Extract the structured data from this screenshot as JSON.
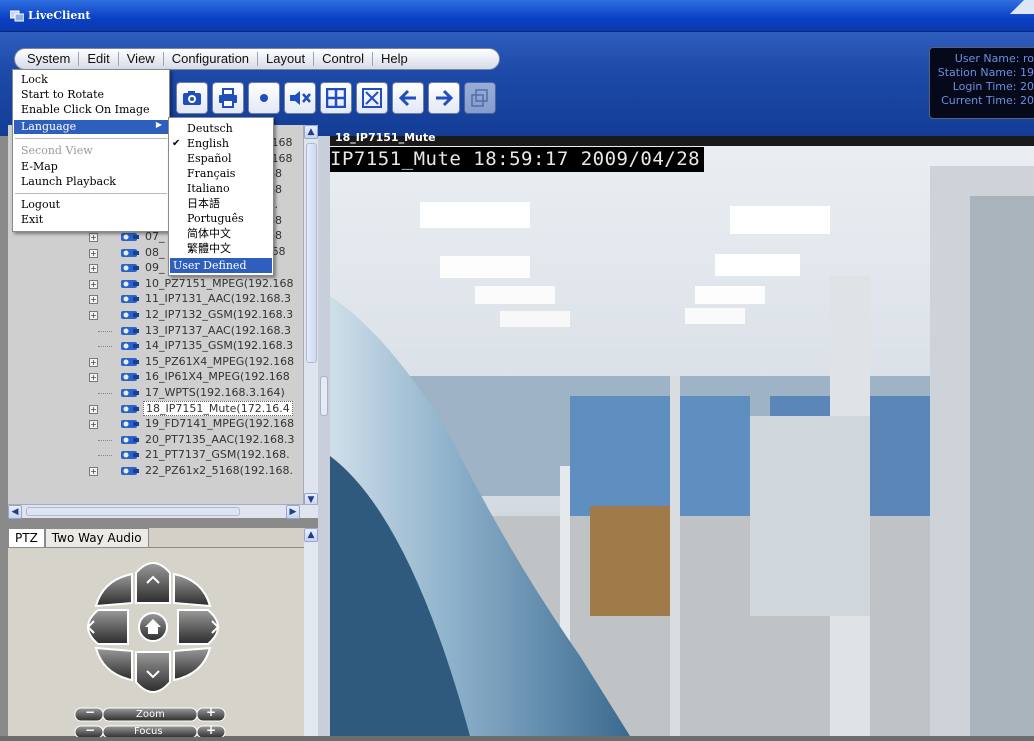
{
  "window": {
    "title": "LiveClient"
  },
  "menubar": {
    "items": [
      "System",
      "Edit",
      "View",
      "Configuration",
      "Layout",
      "Control",
      "Help"
    ]
  },
  "info": {
    "user_name": "User Name: ro",
    "station_name": "Station Name: 19",
    "login_time": "Login Time: 20",
    "current_time": "Current Time: 20"
  },
  "system_menu": {
    "items": [
      {
        "label": "Lock",
        "state": "normal"
      },
      {
        "label": "Start to Rotate",
        "state": "normal"
      },
      {
        "label": "Enable Click On Image",
        "state": "normal"
      },
      {
        "label": "Language",
        "state": "highlighted",
        "submenu": true
      },
      {
        "label": "Second View",
        "state": "disabled"
      },
      {
        "label": "E-Map",
        "state": "normal"
      },
      {
        "label": "Launch Playback",
        "state": "normal"
      },
      {
        "label": "Logout",
        "state": "normal"
      },
      {
        "label": "Exit",
        "state": "normal"
      }
    ]
  },
  "language_menu": {
    "items": [
      "Deutsch",
      "English",
      "Español",
      "Français",
      "Italiano",
      "日本語",
      "Português",
      "简体中文",
      "繁體中文",
      "User Defined"
    ],
    "checked": "English",
    "highlighted": "User Defined"
  },
  "tree": {
    "items": [
      {
        "label": "07_",
        "expand": true
      },
      {
        "label": "08_",
        "expand": true
      },
      {
        "label": "09_",
        "expand": true
      },
      {
        "label": "10_PZ7151_MPEG(192.168",
        "expand": true
      },
      {
        "label": "11_IP7131_AAC(192.168.3",
        "expand": true
      },
      {
        "label": "12_IP7132_GSM(192.168.3",
        "expand": true
      },
      {
        "label": "13_IP7137_AAC(192.168.3",
        "expand": false
      },
      {
        "label": "14_IP7135_GSM(192.168.3",
        "expand": false
      },
      {
        "label": "15_PZ61X4_MPEG(192.168",
        "expand": true
      },
      {
        "label": "16_IP61X4_MPEG(192.168",
        "expand": true
      },
      {
        "label": "17_WPTS(192.168.3.164)",
        "expand": false
      },
      {
        "label": "18_IP7151_Mute(172.16.4",
        "expand": true,
        "selected": true
      },
      {
        "label": "19_FD7141_MPEG(192.168",
        "expand": true
      },
      {
        "label": "20_PT7135_AAC(192.168.3",
        "expand": false
      },
      {
        "label": "21_PT7137_GSM(192.168.",
        "expand": false
      },
      {
        "label": "22_PZ61x2_5168(192.168.",
        "expand": true
      }
    ],
    "partial_behind_menu": [
      "2.168",
      "2.168",
      "168",
      "168",
      "8.3.",
      "168",
      "168",
      ".168"
    ]
  },
  "ptz": {
    "tabs": [
      "PTZ",
      "Two Way Audio"
    ],
    "zoom_label": "Zoom",
    "focus_label": "Focus"
  },
  "video": {
    "channel_label": "18_IP7151_Mute",
    "osd_text": "IP7151_Mute 18:59:17 2009/04/28"
  },
  "colors": {
    "title_blue": "#0a3fc4",
    "menu_highlight": "#2f5fbd",
    "toolbar_icon": "#1f4fbf"
  }
}
